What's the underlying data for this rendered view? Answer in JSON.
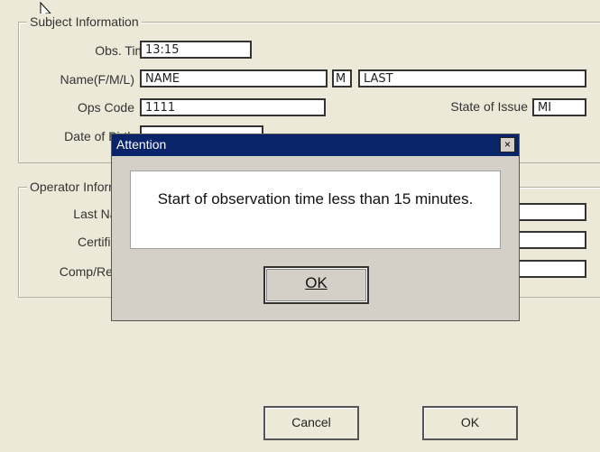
{
  "subject_group": {
    "title": "Subject Information",
    "obs_time_label": "Obs. Time",
    "obs_time_value": "13:15",
    "name_label": "Name(F/M/L)",
    "first_name_value": "NAME",
    "middle_initial_value": "M",
    "last_name_value": "LAST",
    "ops_code_label": "Ops Code",
    "ops_code_value": "1111",
    "state_label": "State of Issue",
    "state_value": "MI",
    "dob_label": "Date of Birth"
  },
  "operator_group": {
    "title": "Operator Information",
    "last_name_label": "Last Name",
    "certificate_label": "Certificate",
    "comp_report_label": "Comp/Report"
  },
  "footer": {
    "cancel_label": "Cancel",
    "ok_label": "OK"
  },
  "dialog": {
    "title": "Attention",
    "close_glyph": "×",
    "message": "Start of observation time less than 15 minutes.",
    "ok_label": "OK"
  }
}
